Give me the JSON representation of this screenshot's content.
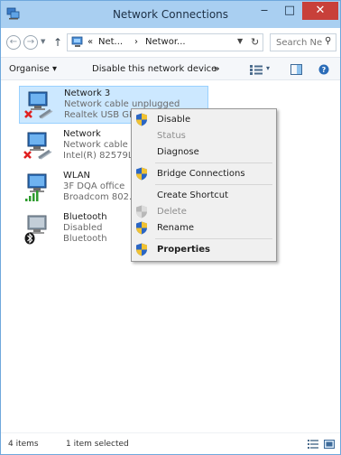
{
  "window": {
    "title": "Network Connections",
    "controls": {
      "minimize": "‒",
      "maximize": "□",
      "close": "✕"
    }
  },
  "address": {
    "back": "←",
    "forward": "→",
    "up": "↑",
    "overflow": "«",
    "crumbs": [
      "Net...",
      "›",
      "Networ..."
    ],
    "refresh": "↻",
    "search_placeholder": "Search Ne...",
    "search_icon": "⚲"
  },
  "commands": {
    "organise": "Organise ▾",
    "disable_device": "Disable this network device",
    "more": "»",
    "view_dropdown": "▾"
  },
  "connections": [
    {
      "name": "Network 3",
      "status": "Network cable unplugged",
      "adapter": "Realtek USB GBE",
      "icon": "wired-disconnected-icon",
      "selected": true
    },
    {
      "name": "Network",
      "status": "Network cable ur",
      "adapter": "Intel(R) 82579LM",
      "icon": "wired-disconnected-icon",
      "selected": false
    },
    {
      "name": "WLAN",
      "status": "3F DQA office",
      "adapter": "Broadcom 802.11",
      "icon": "wireless-signal-icon",
      "selected": false
    },
    {
      "name": "Bluetooth",
      "status": "Disabled",
      "adapter": "Bluetooth",
      "icon": "bluetooth-icon",
      "selected": false
    }
  ],
  "context_menu": [
    {
      "label": "Disable",
      "shield": true,
      "disabled": false,
      "bold": false
    },
    {
      "label": "Status",
      "shield": false,
      "disabled": true,
      "bold": false
    },
    {
      "label": "Diagnose",
      "shield": false,
      "disabled": false,
      "bold": false
    },
    {
      "label": "Bridge Connections",
      "shield": true,
      "disabled": false,
      "bold": false
    },
    {
      "label": "Create Shortcut",
      "shield": false,
      "disabled": false,
      "bold": false
    },
    {
      "label": "Delete",
      "shield": true,
      "disabled": true,
      "bold": false
    },
    {
      "label": "Rename",
      "shield": true,
      "disabled": false,
      "bold": false
    },
    {
      "label": "Properties",
      "shield": true,
      "disabled": false,
      "bold": true
    }
  ],
  "statusbar": {
    "item_count": "4 items",
    "selection": "1 item selected"
  },
  "colors": {
    "titlebar": "#a9cff1",
    "selection": "#cce8ff",
    "close_button": "#c8403a",
    "disconnected_x": "#e02020",
    "signal_green": "#2e9b2e"
  }
}
